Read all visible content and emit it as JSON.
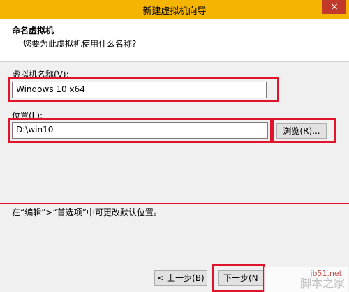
{
  "window": {
    "title": "新建虚拟机向导",
    "close_glyph": "×"
  },
  "header": {
    "title": "命名虚拟机",
    "subtitle": "您要为此虚拟机使用什么名称?"
  },
  "vm_name": {
    "label": "虚拟机名称(V):",
    "value": "Windows 10 x64"
  },
  "location": {
    "label": "位置(L):",
    "value": "D:\\win10",
    "browse_label": "浏览(R)..."
  },
  "hint": "在“编辑”>“首选项”中可更改默认位置。",
  "footer": {
    "back_label": "< 上一步(B)",
    "next_label": "下一步(N"
  },
  "watermark": {
    "url": "jb51.net",
    "name": "脚本之家"
  },
  "colors": {
    "highlight": "#e0142b",
    "titlebar": "#f4b400"
  }
}
